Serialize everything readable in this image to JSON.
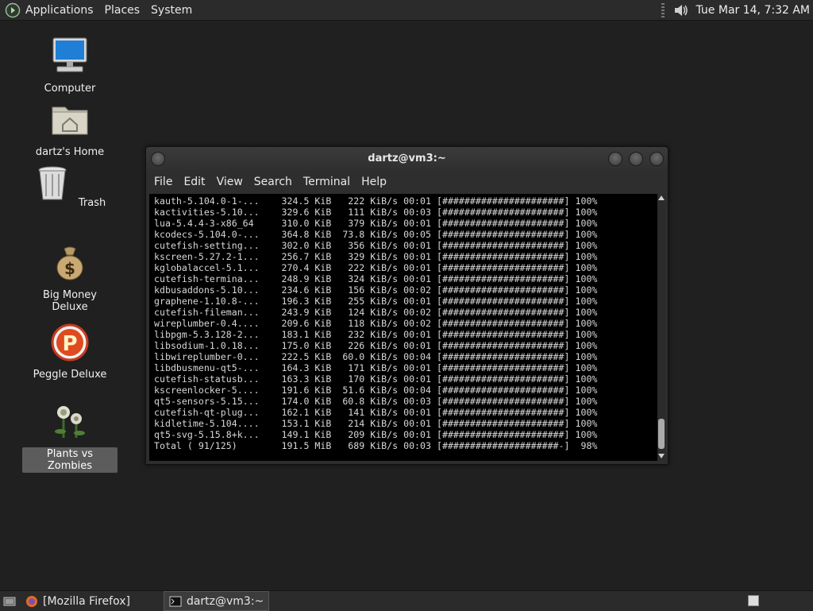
{
  "top_panel": {
    "menus": [
      "Applications",
      "Places",
      "System"
    ],
    "clock": "Tue Mar 14, 7:32 AM"
  },
  "desktop": {
    "icons": [
      {
        "label": "Computer"
      },
      {
        "label": "dartz's Home"
      },
      {
        "label": "Trash"
      },
      {
        "label": "Big Money Deluxe"
      },
      {
        "label": "Peggle Deluxe"
      },
      {
        "label": "Plants vs Zombies"
      }
    ]
  },
  "terminal": {
    "title": "dartz@vm3:~",
    "menu": [
      "File",
      "Edit",
      "View",
      "Search",
      "Terminal",
      "Help"
    ],
    "lines": [
      "kauth-5.104.0-1-...    324.5 KiB   222 KiB/s 00:01 [######################] 100%",
      "kactivities-5.10...    329.6 KiB   111 KiB/s 00:03 [######################] 100%",
      "lua-5.4.4-3-x86_64     310.0 KiB   379 KiB/s 00:01 [######################] 100%",
      "kcodecs-5.104.0-...    364.8 KiB  73.8 KiB/s 00:05 [######################] 100%",
      "cutefish-setting...    302.0 KiB   356 KiB/s 00:01 [######################] 100%",
      "kscreen-5.27.2-1...    256.7 KiB   329 KiB/s 00:01 [######################] 100%",
      "kglobalaccel-5.1...    270.4 KiB   222 KiB/s 00:01 [######################] 100%",
      "cutefish-termina...    248.9 KiB   324 KiB/s 00:01 [######################] 100%",
      "kdbusaddons-5.10...    234.6 KiB   156 KiB/s 00:02 [######################] 100%",
      "graphene-1.10.8-...    196.3 KiB   255 KiB/s 00:01 [######################] 100%",
      "cutefish-fileman...    243.9 KiB   124 KiB/s 00:02 [######################] 100%",
      "wireplumber-0.4....    209.6 KiB   118 KiB/s 00:02 [######################] 100%",
      "libpgm-5.3.128-2...    183.1 KiB   232 KiB/s 00:01 [######################] 100%",
      "libsodium-1.0.18...    175.0 KiB   226 KiB/s 00:01 [######################] 100%",
      "libwireplumber-0...    222.5 KiB  60.0 KiB/s 00:04 [######################] 100%",
      "libdbusmenu-qt5-...    164.3 KiB   171 KiB/s 00:01 [######################] 100%",
      "cutefish-statusb...    163.3 KiB   170 KiB/s 00:01 [######################] 100%",
      "kscreenlocker-5....    191.6 KiB  51.6 KiB/s 00:04 [######################] 100%",
      "qt5-sensors-5.15...    174.0 KiB  60.8 KiB/s 00:03 [######################] 100%",
      "cutefish-qt-plug...    162.1 KiB   141 KiB/s 00:01 [######################] 100%",
      "kidletime-5.104....    153.1 KiB   214 KiB/s 00:01 [######################] 100%",
      "qt5-svg-5.15.8+k...    149.1 KiB   209 KiB/s 00:01 [######################] 100%",
      "Total ( 91/125)        191.5 MiB   689 KiB/s 00:03 [#####################-]  98%"
    ]
  },
  "taskbar": {
    "tasks": [
      {
        "label": "[Mozilla Firefox]"
      },
      {
        "label": "dartz@vm3:~"
      }
    ]
  },
  "colors": {
    "panel": "#2a2b2a",
    "desktop": "#1f201f",
    "terminal_bg": "#000000",
    "terminal_fg": "#d7d7d7"
  }
}
